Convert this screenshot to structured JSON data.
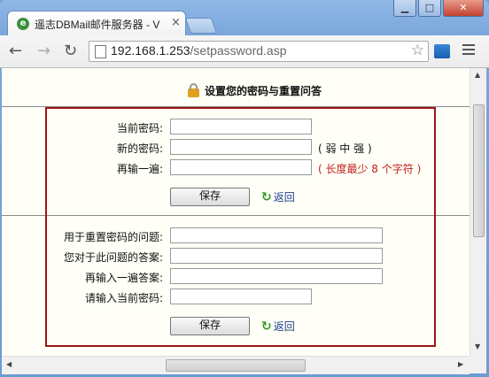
{
  "browser": {
    "tab_title": "遥志DBMail邮件服务器 - V",
    "tab_close": "×",
    "favicon": "e",
    "window_buttons": {
      "minimize": "▁",
      "maximize": "□",
      "close": "✕"
    },
    "nav": {
      "back": "←",
      "forward": "→",
      "reload": "↻"
    },
    "url_host": "192.168.1.253",
    "url_path": "/setpassword.asp",
    "star": "☆",
    "icons": [
      "favicon-icon",
      "back-arrow-icon",
      "forward-arrow-icon",
      "reload-icon",
      "page-icon",
      "star-icon",
      "extension-icon",
      "menu-icon",
      "lock-icon",
      "return-arrow-icon"
    ]
  },
  "page": {
    "heading": "设置您的密码与重置问答",
    "password_section": {
      "current_label": "当前密码:",
      "new_label": "新的密码:",
      "confirm_label": "再输一遍:",
      "strength_note": "( 弱 中 强 )",
      "length_note": "( 长度最少 8 个字符 )",
      "length_note_color": "#c0231b",
      "save_label": "保存",
      "back_label": "返回"
    },
    "question_section": {
      "question_label": "用于重置密码的问题:",
      "answer_label": "您对于此问题的答案:",
      "confirm_answer_label": "再输入一遍答案:",
      "current_password_label": "请输入当前密码:",
      "save_label": "保存",
      "back_label": "返回"
    },
    "frame_color": "#a01515"
  },
  "scroll": {
    "up": "▲",
    "down": "▼",
    "left": "◀",
    "right": "▶"
  }
}
